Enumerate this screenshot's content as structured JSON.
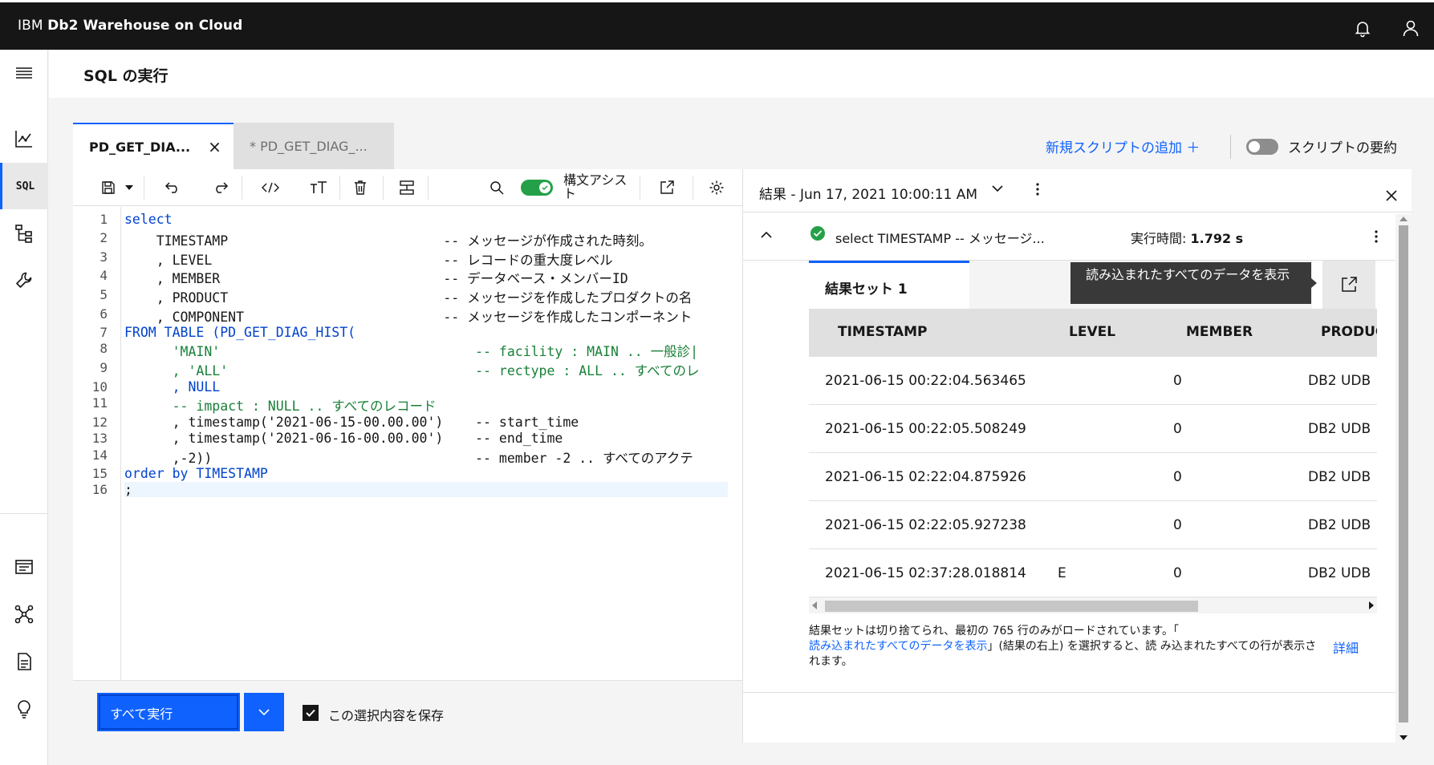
{
  "app": {
    "brand_prefix": "IBM",
    "brand_name": "Db2 Warehouse on Cloud"
  },
  "page": {
    "title": "SQL の実行"
  },
  "rail": {
    "sql_label": "SQL"
  },
  "tabs": [
    {
      "label": "PD_GET_DIA..."
    },
    {
      "label": "* PD_GET_DIAG_..."
    }
  ],
  "actions": {
    "add_script": "新規スクリプトの追加 ＋",
    "script_summary": "スクリプトの要約"
  },
  "toolbar": {
    "syntax_assist": "構文アシスト"
  },
  "editor": {
    "line_numbers": [
      "1",
      "2",
      "3",
      "4",
      "5",
      "6",
      "7",
      "8",
      "9",
      "10",
      "11",
      "12",
      "13",
      "14",
      "15",
      "16"
    ],
    "lines": [
      "select",
      "    TIMESTAMP                           -- メッセージが作成された時刻。",
      "    , LEVEL                             -- レコードの重大度レベル",
      "    , MEMBER                            -- データベース・メンバーID",
      "    , PRODUCT                           -- メッセージを作成したプロダクトの名",
      "    , COMPONENT                         -- メッセージを作成したコンポーネント",
      "FROM TABLE (PD_GET_DIAG_HIST(",
      "      'MAIN'                                -- facility : MAIN .. 一般診|",
      "      , 'ALL'                               -- rectype : ALL .. すべてのレ",
      "      , NULL",
      "      -- impact : NULL .. すべてのレコード",
      "      , timestamp('2021-06-15-00.00.00')    -- start_time",
      "      , timestamp('2021-06-16-00.00.00')    -- end_time",
      "      ,-2))                                 -- member -2 .. すべてのアクテ",
      "order by TIMESTAMP",
      ";"
    ]
  },
  "run": {
    "run_all": "すべて実行",
    "save_choice": "この選択内容を保存"
  },
  "results": {
    "header": "結果 - Jun 17, 2021 10:00:11 AM",
    "query_preview": "select TIMESTAMP -- メッセージ...",
    "exec_time_label": "実行時間:",
    "exec_time_value": "1.792 s",
    "result_set_tab": "結果セット 1",
    "tooltip": "読み込まれたすべてのデータを表示",
    "columns": [
      "TIMESTAMP",
      "LEVEL",
      "MEMBER",
      "PRODUCT"
    ],
    "rows": [
      [
        "2021-06-15 00:22:04.563465",
        "",
        "0",
        "DB2 UDB"
      ],
      [
        "2021-06-15 00:22:05.508249",
        "",
        "0",
        "DB2 UDB"
      ],
      [
        "2021-06-15 02:22:04.875926",
        "",
        "0",
        "DB2 UDB"
      ],
      [
        "2021-06-15 02:22:05.927238",
        "",
        "0",
        "DB2 UDB"
      ],
      [
        "2021-06-15 02:37:28.018814",
        "E",
        "0",
        "DB2 UDB"
      ]
    ],
    "note_part1": "結果セットは切り捨てられ、最初の 765 行のみがロードされています。「",
    "note_link": "読み込まれたすべてのデータを表示",
    "note_part2": "」(結果の右上) を選択すると、読 み込まれたすべての行が表示されます。",
    "details_link": "詳細"
  },
  "colors": {
    "accent": "#0f62fe",
    "success": "#24a148",
    "topbar": "#161616"
  }
}
